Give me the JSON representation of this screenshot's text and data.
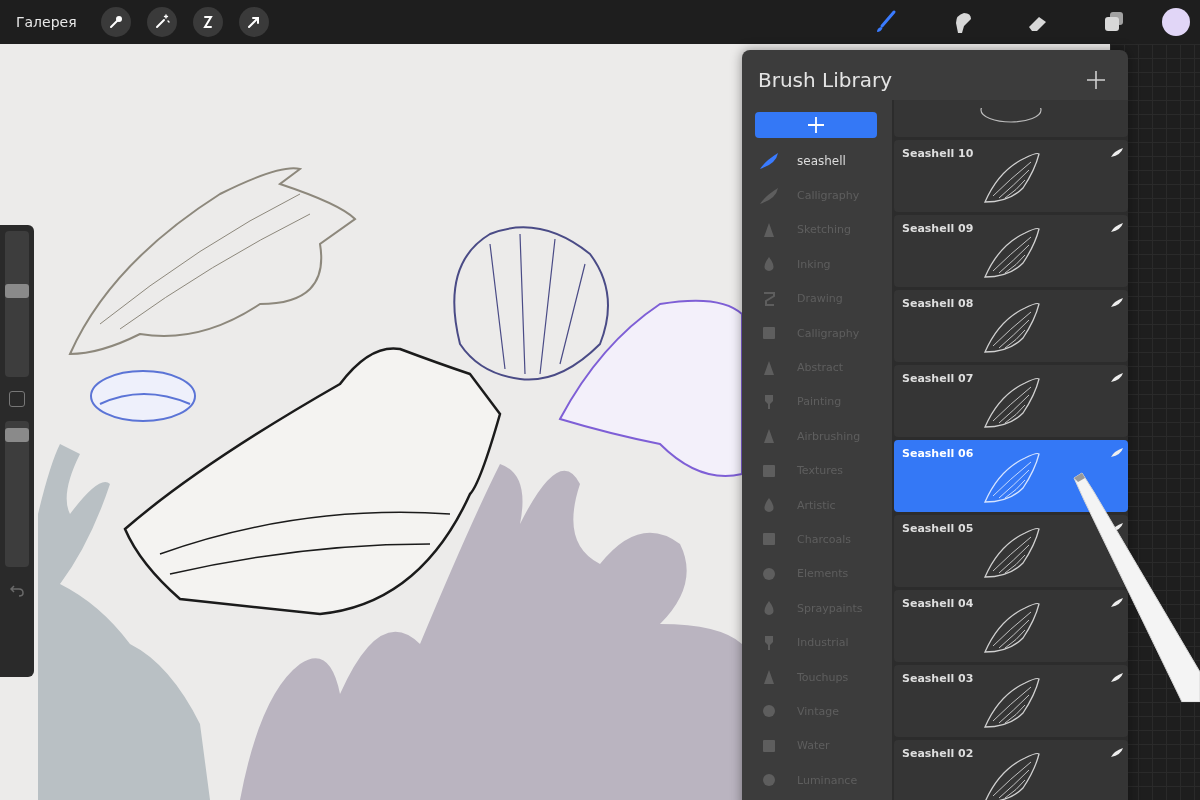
{
  "top_bar": {
    "gallery_label": "Галерея",
    "left_tools": [
      {
        "kind": "wrench"
      },
      {
        "kind": "wand"
      },
      {
        "kind": "curve"
      },
      {
        "kind": "arrow"
      }
    ],
    "right_tools": [
      {
        "kind": "brush",
        "selected": true
      },
      {
        "kind": "smudge",
        "selected": false
      },
      {
        "kind": "eraser",
        "selected": false
      },
      {
        "kind": "layers",
        "selected": false
      }
    ],
    "current_color": {
      "color": "#e1d6f7"
    }
  },
  "sidebar": {
    "size_slider": {
      "level": 0.6
    },
    "opacity_slider": {
      "level": 0.95
    }
  },
  "brush_library": {
    "title": "Brush Library",
    "categories": [
      {
        "label": "seashell",
        "kind": "stroke",
        "selected": true
      },
      {
        "label": "Calligraphy",
        "kind": "stroke",
        "selected": false
      },
      {
        "label": "Sketching",
        "kind": "cone",
        "selected": false
      },
      {
        "label": "Inking",
        "kind": "drop",
        "selected": false
      },
      {
        "label": "Drawing",
        "kind": "curve",
        "selected": false
      },
      {
        "label": "Calligraphy",
        "kind": "square",
        "selected": false
      },
      {
        "label": "Abstract",
        "kind": "cone",
        "selected": false
      },
      {
        "label": "Painting",
        "kind": "brush",
        "selected": false
      },
      {
        "label": "Airbrushing",
        "kind": "cone",
        "selected": false
      },
      {
        "label": "Textures",
        "kind": "square",
        "selected": false
      },
      {
        "label": "Artistic",
        "kind": "drop",
        "selected": false
      },
      {
        "label": "Charcoals",
        "kind": "square",
        "selected": false
      },
      {
        "label": "Elements",
        "kind": "circle",
        "selected": false
      },
      {
        "label": "Spraypaints",
        "kind": "drop",
        "selected": false
      },
      {
        "label": "Industrial",
        "kind": "brush",
        "selected": false
      },
      {
        "label": "Touchups",
        "kind": "cone",
        "selected": false
      },
      {
        "label": "Vintage",
        "kind": "circle",
        "selected": false
      },
      {
        "label": "Water",
        "kind": "square",
        "selected": false
      },
      {
        "label": "Luminance",
        "kind": "circle",
        "selected": false
      }
    ],
    "brushes": [
      {
        "name": "Seashell 10",
        "selected": false
      },
      {
        "name": "Seashell 09",
        "selected": false
      },
      {
        "name": "Seashell 08",
        "selected": false
      },
      {
        "name": "Seashell 07",
        "selected": false
      },
      {
        "name": "Seashell 06",
        "selected": true
      },
      {
        "name": "Seashell 05",
        "selected": false
      },
      {
        "name": "Seashell  04",
        "selected": false
      },
      {
        "name": "Seashell 03",
        "selected": false
      },
      {
        "name": "Seashell 02",
        "selected": false
      }
    ]
  }
}
